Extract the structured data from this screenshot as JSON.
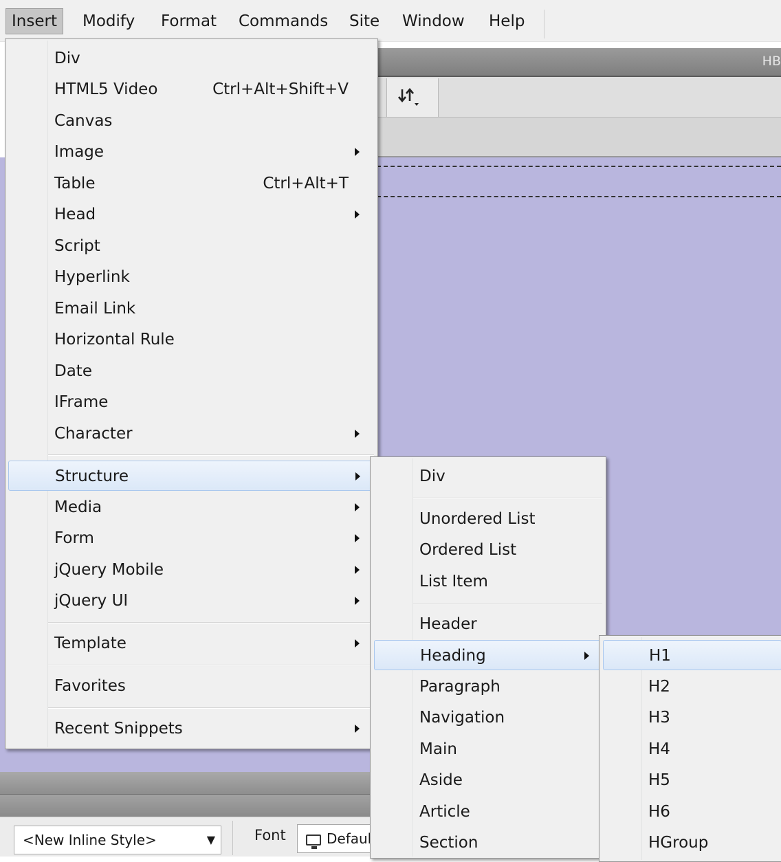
{
  "menubar": {
    "items": [
      "Insert",
      "Modify",
      "Format",
      "Commands",
      "Site",
      "Window",
      "Help"
    ],
    "active": "Insert"
  },
  "panel_bar_label": "HB",
  "insert_menu": {
    "items": [
      {
        "label": "Div"
      },
      {
        "label": "HTML5 Video",
        "shortcut": "Ctrl+Alt+Shift+V"
      },
      {
        "label": "Canvas"
      },
      {
        "label": "Image",
        "submenu": true
      },
      {
        "label": "Table",
        "shortcut": "Ctrl+Alt+T"
      },
      {
        "label": "Head",
        "submenu": true
      },
      {
        "label": "Script"
      },
      {
        "label": "Hyperlink"
      },
      {
        "label": "Email Link"
      },
      {
        "label": "Horizontal Rule"
      },
      {
        "label": "Date"
      },
      {
        "label": "IFrame"
      },
      {
        "label": "Character",
        "submenu": true
      },
      {
        "label": "Structure",
        "submenu": true,
        "highlighted": true
      },
      {
        "label": "Media",
        "submenu": true
      },
      {
        "label": "Form",
        "submenu": true
      },
      {
        "label": "jQuery Mobile",
        "submenu": true
      },
      {
        "label": "jQuery UI",
        "submenu": true
      },
      {
        "label": "Template",
        "submenu": true
      },
      {
        "label": "Favorites"
      },
      {
        "label": "Recent Snippets",
        "submenu": true
      }
    ]
  },
  "structure_menu": {
    "items": [
      {
        "label": "Div"
      },
      {
        "label": "Unordered List"
      },
      {
        "label": "Ordered List"
      },
      {
        "label": "List Item"
      },
      {
        "label": "Header"
      },
      {
        "label": "Heading",
        "submenu": true,
        "highlighted": true
      },
      {
        "label": "Paragraph"
      },
      {
        "label": "Navigation"
      },
      {
        "label": "Main"
      },
      {
        "label": "Aside"
      },
      {
        "label": "Article"
      },
      {
        "label": "Section"
      }
    ]
  },
  "heading_menu": {
    "items": [
      {
        "label": "H1",
        "highlighted": true
      },
      {
        "label": "H2"
      },
      {
        "label": "H3"
      },
      {
        "label": "H4"
      },
      {
        "label": "H5"
      },
      {
        "label": "H6"
      },
      {
        "label": "HGroup"
      }
    ]
  },
  "properties": {
    "style_select": "<New Inline Style>",
    "font_label": "Font",
    "font_value": "Default"
  },
  "colors": {
    "design_view": "#b9b6de",
    "menu_bg": "#f0f0f0",
    "highlight_border": "#a9c7ee"
  }
}
